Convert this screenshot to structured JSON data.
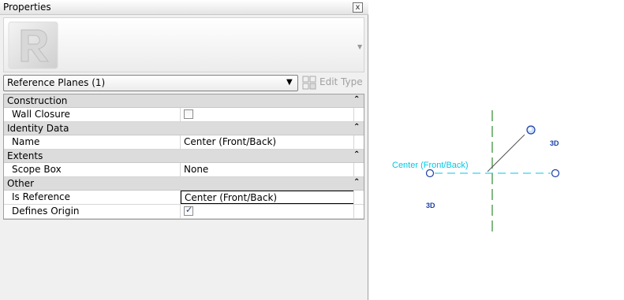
{
  "palette": {
    "title": "Properties",
    "close_glyph": "x",
    "type_selector": "Reference Planes (1)",
    "edit_type_label": "Edit Type",
    "groups": [
      {
        "label": "Construction",
        "collapse_glyph": "⌃",
        "rows": [
          {
            "name": "Wall Closure",
            "kind": "checkbox",
            "checked": false
          }
        ]
      },
      {
        "label": "Identity Data",
        "collapse_glyph": "⌃",
        "rows": [
          {
            "name": "Name",
            "kind": "text",
            "value": "Center (Front/Back)"
          }
        ]
      },
      {
        "label": "Extents",
        "collapse_glyph": "⌃",
        "rows": [
          {
            "name": "Scope Box",
            "kind": "text",
            "value": "None"
          }
        ]
      },
      {
        "label": "Other",
        "collapse_glyph": "⌃",
        "rows": [
          {
            "name": "Is Reference",
            "kind": "editing",
            "value": "Center (Front/Back)"
          },
          {
            "name": "Defines Origin",
            "kind": "checkbox",
            "checked": true
          }
        ]
      }
    ]
  },
  "canvas": {
    "plane_label": "Center (Front/Back)",
    "view_label_1": "3D",
    "view_label_2": "3D",
    "colors": {
      "plane": "#00c8e6",
      "marker": "#1c3fa8",
      "axis": "#2e8b2e"
    }
  }
}
